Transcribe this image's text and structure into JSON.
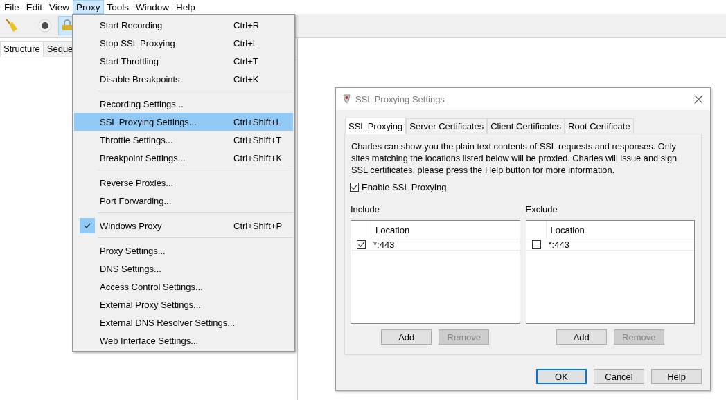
{
  "menubar": [
    {
      "label": "File",
      "selected": false
    },
    {
      "label": "Edit",
      "selected": false
    },
    {
      "label": "View",
      "selected": false
    },
    {
      "label": "Proxy",
      "selected": true
    },
    {
      "label": "Tools",
      "selected": false
    },
    {
      "label": "Window",
      "selected": false
    },
    {
      "label": "Help",
      "selected": false
    }
  ],
  "toolbar": [
    {
      "kind": "broom",
      "selected": false
    },
    {
      "kind": "record",
      "selected": false
    },
    {
      "kind": "lock",
      "selected": true
    }
  ],
  "view_tabs": [
    {
      "label": "Structure",
      "selected": true
    },
    {
      "label": "Seque",
      "selected": false
    }
  ],
  "proxy_menu": {
    "groups": [
      {
        "items": [
          {
            "label": "Start Recording",
            "shortcut": "Ctrl+R",
            "selected": false,
            "checked": false
          },
          {
            "label": "Stop SSL Proxying",
            "shortcut": "Ctrl+L",
            "selected": false,
            "checked": false
          },
          {
            "label": "Start Throttling",
            "shortcut": "Ctrl+T",
            "selected": false,
            "checked": false
          },
          {
            "label": "Disable Breakpoints",
            "shortcut": "Ctrl+K",
            "selected": false,
            "checked": false
          }
        ]
      },
      {
        "items": [
          {
            "label": "Recording Settings...",
            "selected": false,
            "checked": false
          },
          {
            "label": "SSL Proxying Settings...",
            "shortcut": "Ctrl+Shift+L",
            "selected": true,
            "checked": false
          },
          {
            "label": "Throttle Settings...",
            "shortcut": "Ctrl+Shift+T",
            "selected": false,
            "checked": false
          },
          {
            "label": "Breakpoint Settings...",
            "shortcut": "Ctrl+Shift+K",
            "selected": false,
            "checked": false
          }
        ]
      },
      {
        "items": [
          {
            "label": "Reverse Proxies...",
            "selected": false,
            "checked": false
          },
          {
            "label": "Port Forwarding...",
            "selected": false,
            "checked": false
          }
        ]
      },
      {
        "items": [
          {
            "label": "Windows Proxy",
            "shortcut": "Ctrl+Shift+P",
            "selected": false,
            "checked": true
          }
        ]
      },
      {
        "items": [
          {
            "label": "Proxy Settings...",
            "selected": false,
            "checked": false
          },
          {
            "label": "DNS Settings...",
            "selected": false,
            "checked": false
          },
          {
            "label": "Access Control Settings...",
            "selected": false,
            "checked": false
          },
          {
            "label": "External Proxy Settings...",
            "selected": false,
            "checked": false
          },
          {
            "label": "External DNS Resolver Settings...",
            "selected": false,
            "checked": false
          },
          {
            "label": "Web Interface Settings...",
            "selected": false,
            "checked": false
          }
        ]
      }
    ]
  },
  "dialog": {
    "title": "SSL Proxying Settings",
    "tabs": [
      {
        "label": "SSL Proxying",
        "selected": true
      },
      {
        "label": "Server Certificates",
        "selected": false
      },
      {
        "label": "Client Certificates",
        "selected": false
      },
      {
        "label": "Root Certificate",
        "selected": false
      }
    ],
    "description": "Charles can show you the plain text contents of SSL requests and responses. Only sites matching the locations listed below will be proxied. Charles will issue and sign SSL certificates, please press the Help button for more information.",
    "enable": {
      "label": "Enable SSL Proxying",
      "checked": true
    },
    "lists": [
      {
        "title": "Include",
        "column": "Location",
        "rows": [
          {
            "location": "*:443",
            "checked": true
          }
        ],
        "buttons": [
          {
            "label": "Add",
            "disabled": false
          },
          {
            "label": "Remove",
            "disabled": true
          }
        ]
      },
      {
        "title": "Exclude",
        "column": "Location",
        "rows": [
          {
            "location": "*:443",
            "checked": false
          }
        ],
        "buttons": [
          {
            "label": "Add",
            "disabled": false
          },
          {
            "label": "Remove",
            "disabled": true
          }
        ]
      }
    ],
    "buttons": [
      {
        "label": "OK",
        "default": true
      },
      {
        "label": "Cancel",
        "default": false
      },
      {
        "label": "Help",
        "default": false
      }
    ]
  }
}
